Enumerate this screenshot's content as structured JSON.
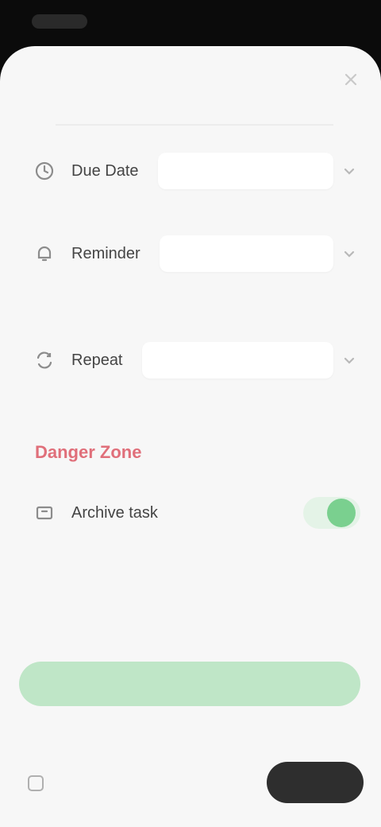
{
  "status_bar": {
    "time": ""
  },
  "sheet": {
    "close_icon": "close-icon",
    "rows": [
      {
        "icon": "clock-icon",
        "label": "Due Date",
        "value": ""
      },
      {
        "icon": "bell-icon",
        "label": "Reminder",
        "value": ""
      },
      {
        "icon": "repeat-icon",
        "label": "Repeat",
        "value": ""
      }
    ],
    "hints": [
      "",
      ""
    ],
    "danger_section": {
      "title": "Danger Zone",
      "toggle_label": "Archive task",
      "toggle_on": true
    },
    "banner": {
      "text": ""
    },
    "footer": {
      "left_label": "",
      "primary_label": ""
    }
  },
  "colors": {
    "background": "#f7f7f7",
    "accent_green": "#7ad08f",
    "banner_green": "#bfe6c7",
    "danger_red": "#e06f7a",
    "primary_dark": "#2e2e2e"
  }
}
